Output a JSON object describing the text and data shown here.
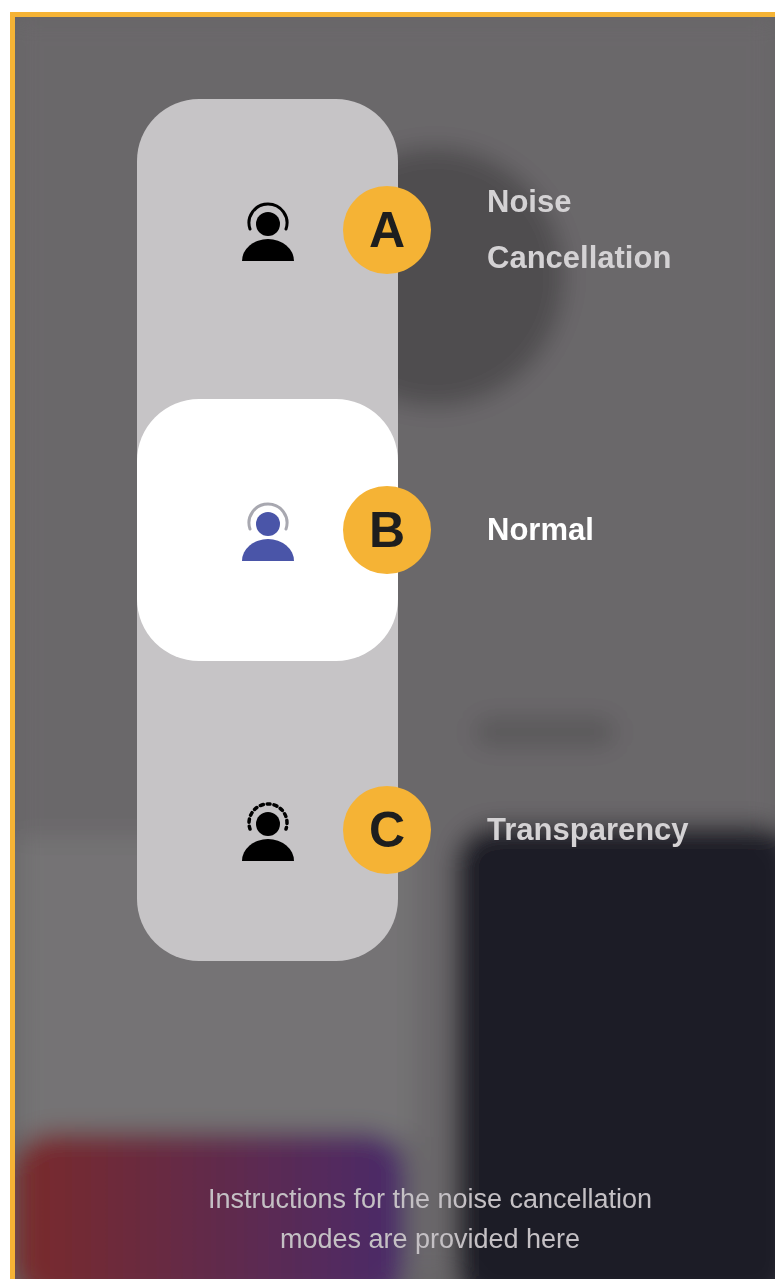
{
  "modes": [
    {
      "kind": "noise-cancellation",
      "badge": "A",
      "label": "Noise Cancellation",
      "selected": false
    },
    {
      "kind": "normal",
      "badge": "B",
      "label": "Normal",
      "selected": true
    },
    {
      "kind": "transparency",
      "badge": "C",
      "label": "Transparency",
      "selected": false
    }
  ],
  "caption": "Instructions for the noise cancellation modes are provided here"
}
